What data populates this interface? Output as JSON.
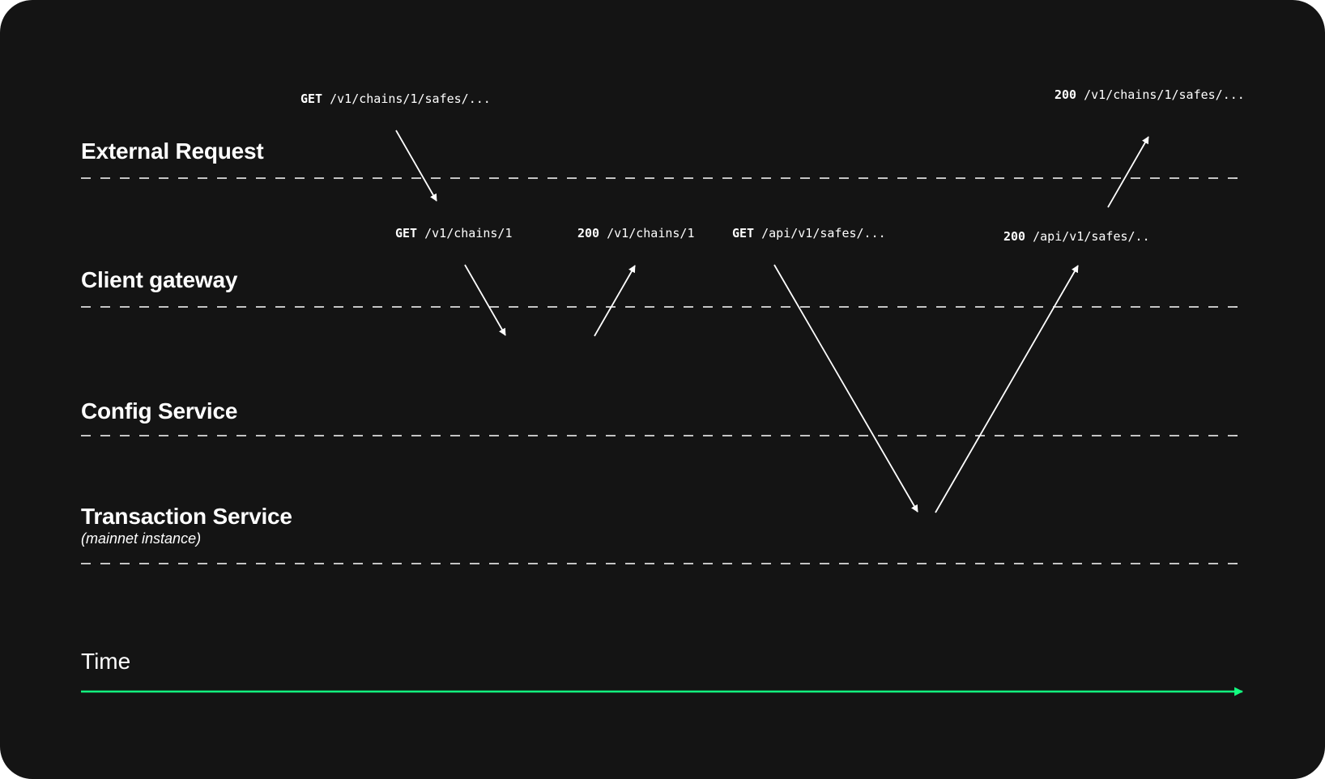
{
  "lanes": [
    {
      "label": "External Request"
    },
    {
      "label": "Client gateway"
    },
    {
      "label": "Config Service"
    },
    {
      "label": "Transaction Service",
      "sublabel": "(mainnet instance)"
    }
  ],
  "requests": [
    {
      "method": "GET",
      "path": "/v1/chains/1/safes/..."
    },
    {
      "method": "GET",
      "path": "/v1/chains/1"
    },
    {
      "method": "200",
      "path": "/v1/chains/1"
    },
    {
      "method": "GET",
      "path": "/api/v1/safes/..."
    },
    {
      "method": "200",
      "path": "/api/v1/safes/.."
    },
    {
      "method": "200",
      "path": "/v1/chains/1/safes/..."
    }
  ],
  "time": {
    "label": "Time"
  },
  "colors": {
    "background": "#141414",
    "foreground": "#ffffff",
    "time_axis": "#12ff80"
  }
}
